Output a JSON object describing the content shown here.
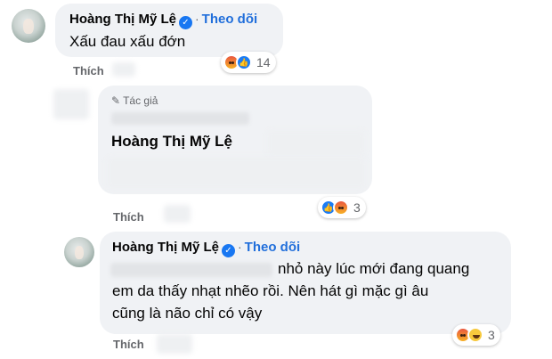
{
  "comment1": {
    "author": "Hoàng Thị Mỹ Lệ",
    "verified_icon": "verified-badge-icon",
    "follow_label": "Theo dõi",
    "text": "Xấu đau xấu đớn",
    "like_label": "Thích",
    "reactions": [
      "angry",
      "like"
    ],
    "reaction_count": "14"
  },
  "reply1": {
    "author_tag": "Tác giả",
    "author": "Hoàng Thị Mỹ Lệ",
    "like_label": "Thích",
    "reactions": [
      "like",
      "angry"
    ],
    "reaction_count": "3"
  },
  "reply2": {
    "author": "Hoàng Thị Mỹ Lệ",
    "follow_label": "Theo dõi",
    "line1": "nhỏ này lúc mới đang quang",
    "line2": "em da thấy nhạt nhẽo rồi. Nên hát gì mặc gì âu",
    "line3": "cũng là não chỉ có vậy",
    "like_label": "Thích",
    "reactions": [
      "angry",
      "haha"
    ],
    "reaction_count": "3"
  },
  "colors": {
    "bubble": "#f0f2f5",
    "link": "#216fdb",
    "meta": "#65676b",
    "verified": "#1877f2"
  }
}
